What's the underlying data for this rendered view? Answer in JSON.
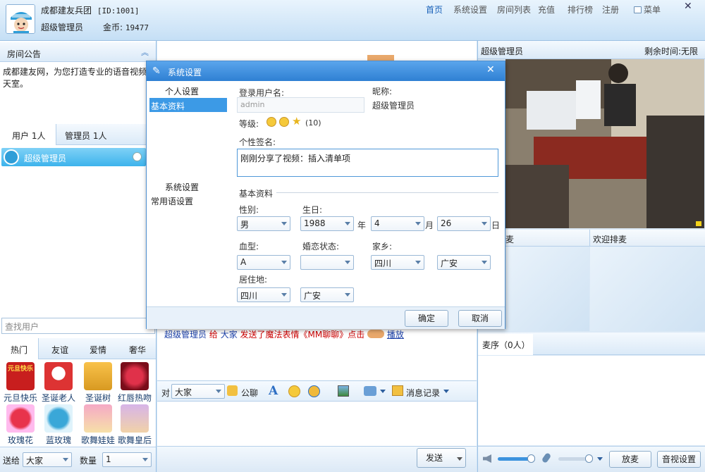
{
  "header": {
    "room_name": "成都建友兵团",
    "room_id": "[ID:1001]",
    "user_title": "超级管理员",
    "coins_label": "金币:",
    "coins_value": "19477",
    "nav": [
      "首页",
      "系统设置",
      "房间列表",
      "充值",
      "排行榜",
      "注册"
    ],
    "menu_label": "菜单",
    "avatar_text": "建友兵团"
  },
  "left": {
    "notice_title": "房间公告",
    "notice_text": "成都建友网，为您打造专业的语音视频天室。",
    "tabs": [
      "用户 1人",
      "管理员 1人"
    ],
    "users": [
      {
        "name": "超级管理员"
      }
    ],
    "search_placeholder": "查找用户",
    "gift_tabs": [
      "热门",
      "友谊",
      "爱情",
      "奢华"
    ],
    "gifts": [
      "元旦快乐",
      "圣诞老人",
      "圣诞树",
      "红唇热吻",
      "玫瑰花",
      "蓝玫瑰",
      "歌舞娃娃",
      "歌舞皇后"
    ],
    "gift_pic_text": "元旦快乐",
    "send_to_label": "送给",
    "send_to_value": "大家",
    "qty_label": "数量",
    "qty_value": "1"
  },
  "center": {
    "chat_line": {
      "from": "超级管理员",
      "gave": "给",
      "to": "大家",
      "action": "发送了魔法表情《MM聊聊》点击",
      "link": "播放"
    },
    "to_label": "对",
    "to_value": "大家",
    "public_label": "公聊",
    "history_label": "消息记录",
    "send_label": "发送"
  },
  "right": {
    "video_user": "超级管理员",
    "remaining_label": "剩余时间:",
    "remaining_value": "无限",
    "mic_label_partial": "麦",
    "welcome_queue": "欢迎排麦",
    "queue_label": "麦序（0人）",
    "leave_mic": "放麦",
    "av_settings": "音视设置"
  },
  "dialog": {
    "title": "系统设置",
    "side_section1": "个人设置",
    "side_item_selected": "基本资料",
    "side_section2": "系统设置",
    "side_item2": "常用语设置",
    "login_label": "登录用户名:",
    "login_value": "admin",
    "nick_label": "昵称:",
    "nick_value": "超级管理员",
    "level_label": "等级:",
    "level_value": "(10)",
    "signature_label": "个性签名:",
    "signature_value": "刚刚分享了视频：插入清单项",
    "basic_label": "基本资料",
    "gender_label": "性别:",
    "gender_value": "男",
    "birthday_label": "生日:",
    "year_value": "1988",
    "year_unit": "年",
    "month_value": "4",
    "month_unit": "月",
    "day_value": "26",
    "day_unit": "日",
    "blood_label": "血型:",
    "blood_value": "A",
    "marital_label": "婚恋状态:",
    "marital_value": "",
    "hometown_label": "家乡:",
    "hometown_prov": "四川",
    "hometown_city": "广安",
    "residence_label": "居住地:",
    "residence_prov": "四川",
    "residence_city": "广安",
    "ok": "确定",
    "cancel": "取消"
  }
}
